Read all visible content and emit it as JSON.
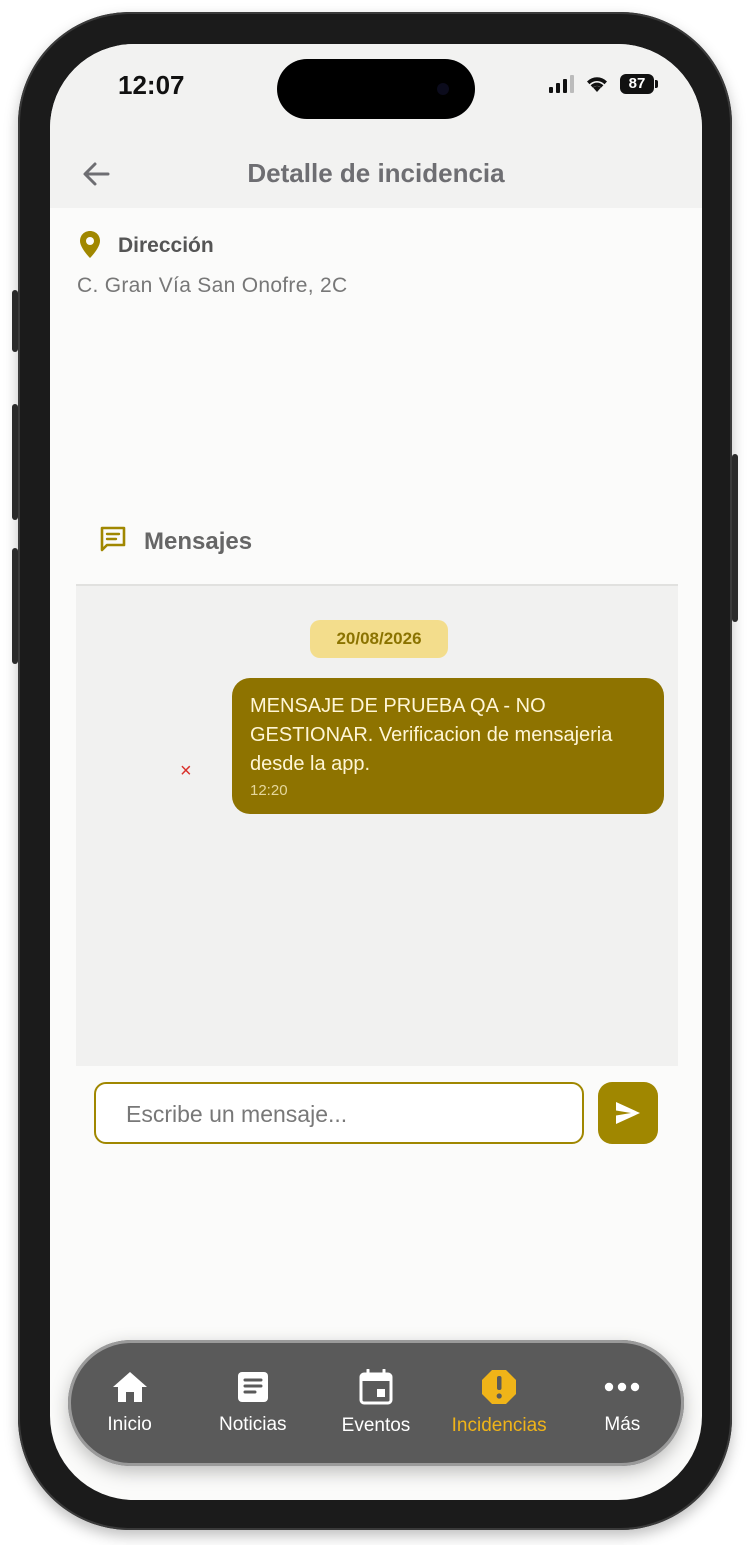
{
  "status": {
    "time": "12:07",
    "battery": "87"
  },
  "header": {
    "title": "Detalle de incidencia"
  },
  "address": {
    "label": "Dirección",
    "value": "C. Gran Vía San Onofre, 2C"
  },
  "messages": {
    "title": "Mensajes",
    "date_chip": "20/08/2026",
    "items": [
      {
        "text": "MENSAJE DE PRUEBA QA - NO GESTIONAR. Verificacion de mensajeria desde la app.",
        "time": "12:20",
        "error_mark": "×"
      }
    ]
  },
  "composer": {
    "placeholder": "Escribe un mensaje..."
  },
  "tabs": [
    {
      "label": "Inicio",
      "icon": "home-icon",
      "active": false
    },
    {
      "label": "Noticias",
      "icon": "news-icon",
      "active": false
    },
    {
      "label": "Eventos",
      "icon": "calendar-icon",
      "active": false
    },
    {
      "label": "Incidencias",
      "icon": "alert-icon",
      "active": true
    },
    {
      "label": "Más",
      "icon": "more-icon",
      "active": false
    }
  ],
  "colors": {
    "accent": "#a08700",
    "bubble": "#8e7300",
    "chip": "#f3dd8c",
    "active_tab": "#f0b418",
    "tabbar": "#5a5a5a"
  }
}
